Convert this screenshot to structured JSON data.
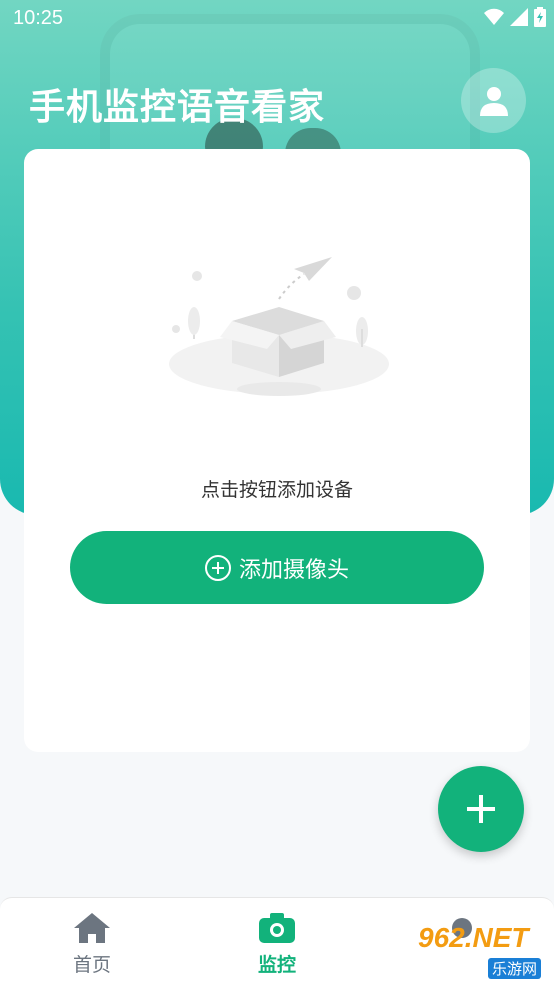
{
  "status": {
    "time": "10:25"
  },
  "app": {
    "title": "手机监控语音看家"
  },
  "card": {
    "empty_text": "点击按钮添加设备",
    "add_button_label": "添加摄像头"
  },
  "nav": {
    "items": [
      {
        "label": "首页",
        "icon": "home-icon"
      },
      {
        "label": "监控",
        "icon": "camera-icon"
      }
    ]
  },
  "watermark": {
    "brand": "962.NET",
    "sub": "乐游网"
  },
  "colors": {
    "accent": "#12b27b",
    "hero_top": "#72d6c2",
    "hero_bottom": "#19b9b0"
  }
}
